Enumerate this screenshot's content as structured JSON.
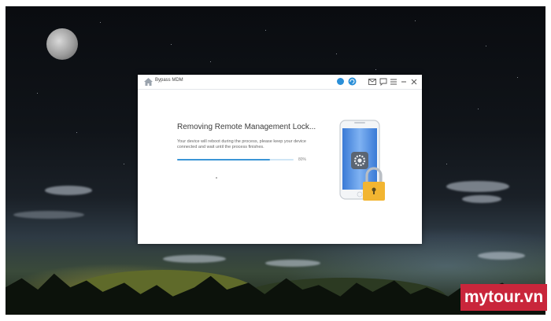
{
  "app": {
    "title": "Bypass MDM"
  },
  "titlebar_icons": [
    "account-icon",
    "update-icon",
    "mail-icon",
    "feedback-icon",
    "menu-icon",
    "minimize-icon",
    "close-icon"
  ],
  "main": {
    "heading": "Removing Remote Management Lock...",
    "description": "Your device will reboot during the process, please keep your device connected and wait until the process finishes.",
    "progress_percent": 80,
    "progress_label": "80%"
  },
  "watermark": {
    "text": "mytour.vn"
  },
  "colors": {
    "accent": "#3b95d6",
    "progress_track": "#cfe6f6",
    "lock_gold": "#f2b531",
    "brand_red": "#c9263b"
  }
}
